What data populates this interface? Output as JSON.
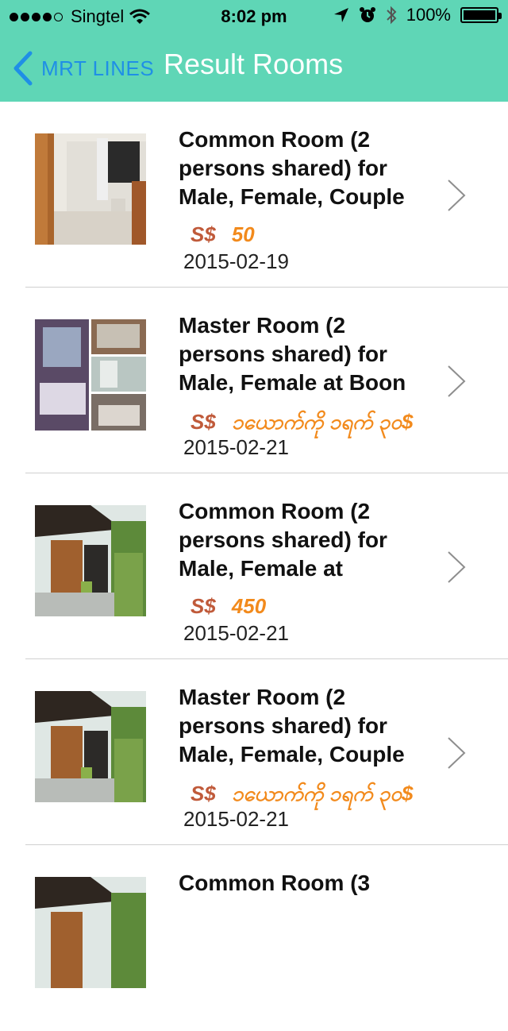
{
  "status": {
    "carrier": "Singtel",
    "time": "8:02 pm",
    "battery": "100%"
  },
  "nav": {
    "back_label": "MRT LINES",
    "title": "Result Rooms"
  },
  "rooms": [
    {
      "title": "Common Room (2 persons shared) for Male, Female, Couple",
      "currency": "S$",
      "price": "50",
      "date": "2015-02-19"
    },
    {
      "title": "Master Room (2 persons shared) for Male, Female at Boon",
      "currency": "S$",
      "price": "၁ယောက်ကို ၁ရက် ၃၀$",
      "date": "2015-02-21"
    },
    {
      "title": "Common Room (2 persons shared) for Male, Female at",
      "currency": "S$",
      "price": "450",
      "date": "2015-02-21"
    },
    {
      "title": "Master Room (2 persons shared) for Male, Female, Couple",
      "currency": "S$",
      "price": "၁ယောက်ကို ၁ရက် ၃၀$",
      "date": "2015-02-21"
    },
    {
      "title": "Common Room (3",
      "currency": "",
      "price": "",
      "date": ""
    }
  ]
}
